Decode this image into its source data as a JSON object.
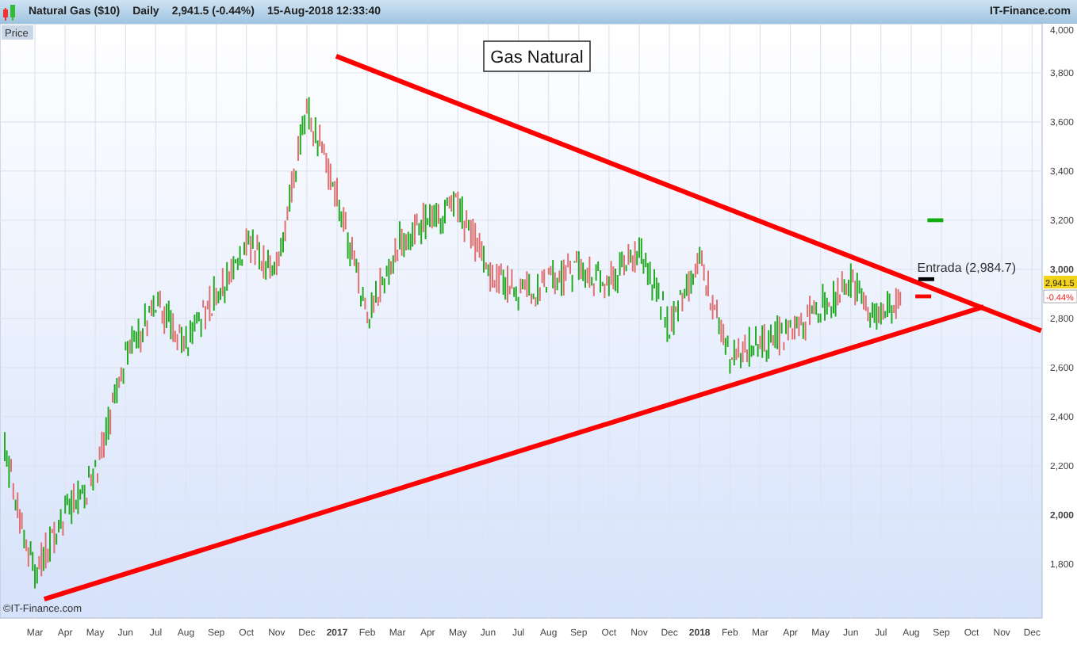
{
  "header": {
    "symbol": "Natural Gas ($10)",
    "interval": "Daily",
    "quote": "2,941.5 (-0.44%)",
    "timestamp": "15-Aug-2018 12:33:40",
    "brand": "IT-Finance.com"
  },
  "chart": {
    "title": "Gas Natural",
    "axis_title": "Price",
    "copyright": "©IT-Finance.com",
    "entry_label": "Entrada (2,984.7)",
    "last_price": {
      "value": "2,941.5",
      "change": "-0.44%"
    },
    "price_axis": [
      {
        "label": "4,000",
        "major": false
      },
      {
        "label": "3,800",
        "major": false
      },
      {
        "label": "3,600",
        "major": false
      },
      {
        "label": "3,400",
        "major": false
      },
      {
        "label": "3,200",
        "major": false
      },
      {
        "label": "3,000",
        "major": true
      },
      {
        "label": "2,800",
        "major": false
      },
      {
        "label": "2,600",
        "major": false
      },
      {
        "label": "2,400",
        "major": false
      },
      {
        "label": "2,200",
        "major": false
      },
      {
        "label": "2,000",
        "major": true
      },
      {
        "label": "1,800",
        "major": false
      }
    ],
    "time_axis": [
      {
        "label": "Mar",
        "major": false
      },
      {
        "label": "Apr",
        "major": false
      },
      {
        "label": "May",
        "major": false
      },
      {
        "label": "Jun",
        "major": false
      },
      {
        "label": "Jul",
        "major": false
      },
      {
        "label": "Aug",
        "major": false
      },
      {
        "label": "Sep",
        "major": false
      },
      {
        "label": "Oct",
        "major": false
      },
      {
        "label": "Nov",
        "major": false
      },
      {
        "label": "Dec",
        "major": false
      },
      {
        "label": "2017",
        "major": true
      },
      {
        "label": "Feb",
        "major": false
      },
      {
        "label": "Mar",
        "major": false
      },
      {
        "label": "Apr",
        "major": false
      },
      {
        "label": "May",
        "major": false
      },
      {
        "label": "Jun",
        "major": false
      },
      {
        "label": "Jul",
        "major": false
      },
      {
        "label": "Aug",
        "major": false
      },
      {
        "label": "Sep",
        "major": false
      },
      {
        "label": "Oct",
        "major": false
      },
      {
        "label": "Nov",
        "major": false
      },
      {
        "label": "Dec",
        "major": false
      },
      {
        "label": "2018",
        "major": true
      },
      {
        "label": "Feb",
        "major": false
      },
      {
        "label": "Mar",
        "major": false
      },
      {
        "label": "Apr",
        "major": false
      },
      {
        "label": "May",
        "major": false
      },
      {
        "label": "Jun",
        "major": false
      },
      {
        "label": "Jul",
        "major": false
      },
      {
        "label": "Aug",
        "major": false
      },
      {
        "label": "Sep",
        "major": false
      },
      {
        "label": "Oct",
        "major": false
      },
      {
        "label": "Nov",
        "major": false
      },
      {
        "label": "Dec",
        "major": false
      }
    ]
  }
}
